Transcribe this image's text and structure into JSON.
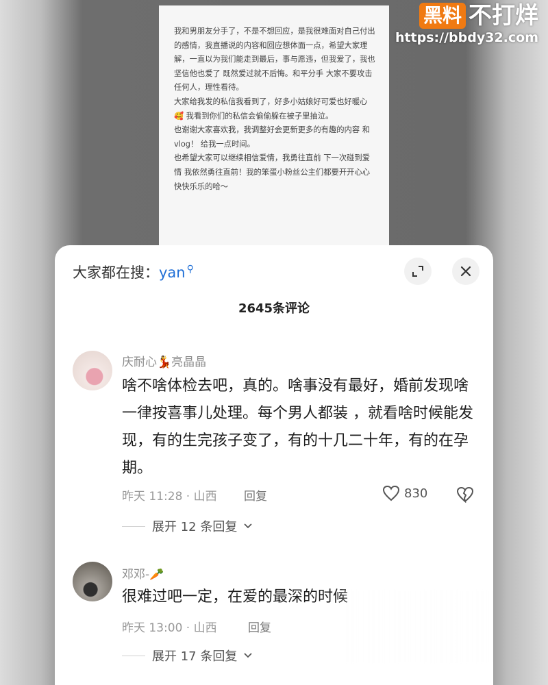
{
  "post": {
    "paragraphs": [
      "我和男朋友分手了，不是不想回应，是我很难面对自己付出的感情，我直播说的内容和回应想体面一点，希望大家理解，一直以为我们能走到最后，事与愿违，但我爱了，我也坚信他也爱了 既然爱过就不后悔。和平分手 大家不要攻击任何人，理性看待。",
      "大家给我发的私信我看到了，好多小姑娘好可爱也好暖心 🥰 我看到你们的私信会偷偷躲在被子里抽泣。",
      "也谢谢大家喜欢我，我调整好会更新更多的有趣的内容 和vlog！ 给我一点时间。",
      "也希望大家可以继续相信爱情，我勇往直前 下一次碰到爱情 我依然勇往直前！我的笨蛋小粉丝公主们都要开开心心快快乐乐的哈～"
    ]
  },
  "watermark": {
    "badge": "黑料",
    "text": "不打烊",
    "url": "https://bbdy32.com"
  },
  "sheet": {
    "search_prefix": "大家都在搜：",
    "search_keyword": "yan",
    "comment_count": "2645条评论"
  },
  "comments": [
    {
      "user": "庆耐心💃亮晶晶",
      "text": "啥不啥体检去吧，真的。啥事没有最好，婚前发现啥一律按喜事儿处理。每个男人都装 ，就看啥时候能发现，有的生完孩子变了，有的十几二十年，有的在孕期。",
      "meta": "昨天 11:28 · 山西",
      "reply": "回复",
      "likes": "830",
      "expand": "展开 12 条回复"
    },
    {
      "user": "邓邓-🥕",
      "text": "很难过吧一定，在爱的最深的时候",
      "meta": "昨天 13:00 · 山西",
      "reply": "回复",
      "expand": "展开 17 条回复"
    }
  ],
  "icons": {
    "search": "search-icon",
    "expand": "expand-icon",
    "close": "close-icon",
    "like": "heart-icon",
    "dislike": "broken-heart-icon",
    "chevron": "chevron-down-icon"
  },
  "colors": {
    "keyword": "#1e6ed6",
    "watermark_badge": "#f07a12"
  }
}
